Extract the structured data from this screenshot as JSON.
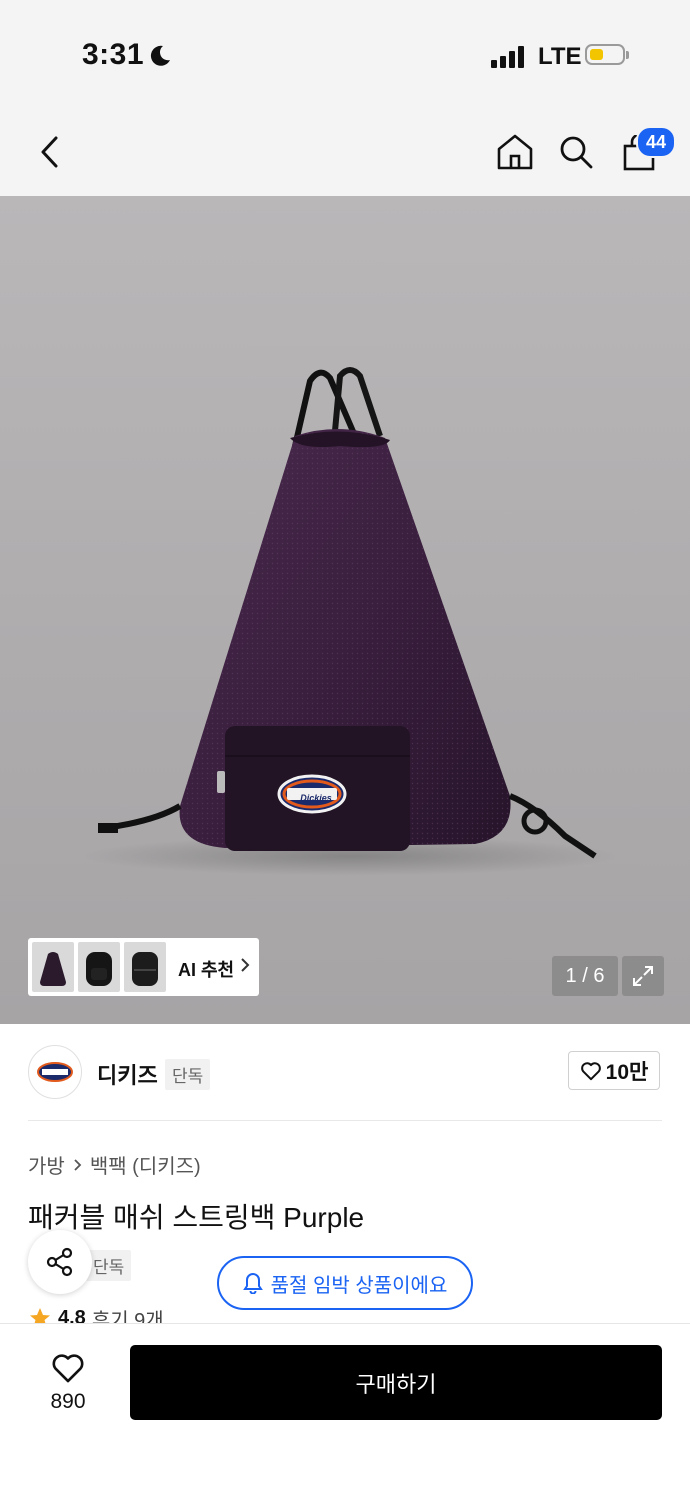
{
  "status_bar": {
    "time": "3:31",
    "network": "LTE"
  },
  "header": {
    "cart_count": "44"
  },
  "hero": {
    "ai_recommend_label": "AI 추천",
    "pager": "1 / 6",
    "product_logo_text": "Dickies"
  },
  "brand": {
    "name": "디키즈",
    "tag": "단독",
    "likes": "10만"
  },
  "breadcrumb": [
    "가방",
    "백팩 (디키즈)"
  ],
  "product": {
    "title": "패커블 매쉬 스트링백 Purple",
    "tag": "단독",
    "soldout_notice": "품절 임박 상품이에요",
    "rating": "4.8",
    "reviews": "후기 9개"
  },
  "bottom_bar": {
    "like_count": "890",
    "buy_label": "구매하기"
  },
  "colors": {
    "accent": "#1a63f3",
    "bag": "#3a1f3d",
    "buy_button": "#000000"
  }
}
